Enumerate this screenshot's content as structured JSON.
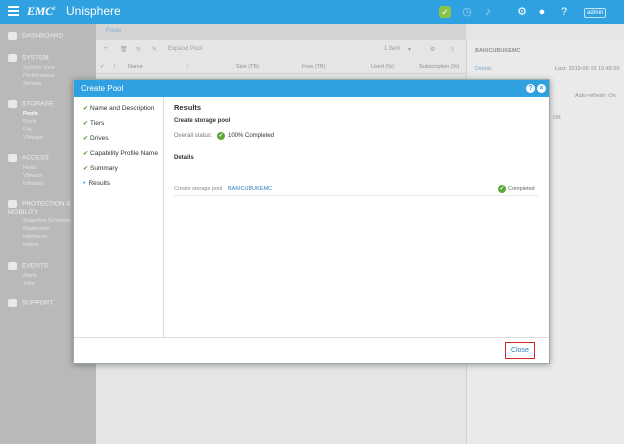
{
  "header": {
    "brand": "EMC",
    "brand_mark": "2",
    "product": "Unisphere",
    "user_label": "admin"
  },
  "icons": {
    "menu": "hamburger-icon",
    "status": "check-badge-icon",
    "tasks": "clock-icon",
    "alerts": "bell-icon",
    "settings": "gear-icon",
    "user": "user-icon",
    "help": "help-icon"
  },
  "sidebar": {
    "sections": [
      {
        "label": "DASHBOARD",
        "items": []
      },
      {
        "label": "SYSTEM",
        "items": [
          "System View",
          "Performance",
          "Service"
        ]
      },
      {
        "label": "STORAGE",
        "items": [
          "Pools",
          "Block",
          "File",
          "VMware"
        ]
      },
      {
        "label": "ACCESS",
        "items": [
          "Hosts",
          "VMware",
          "Initiators"
        ]
      },
      {
        "label": "PROTECTION & MOBILITY",
        "items": [
          "Snapshot Schedule",
          "Replication",
          "Interfaces",
          "Import"
        ]
      },
      {
        "label": "EVENTS",
        "items": [
          "Alerts",
          "Jobs"
        ]
      },
      {
        "label": "SUPPORT",
        "items": []
      }
    ],
    "active_item": "Pools"
  },
  "background": {
    "tab": "Pools",
    "toolbar": {
      "expand_pool": "Expand Pool",
      "item_count": "1 item"
    },
    "columns": [
      "!",
      "Name",
      "↑",
      "Size (TB)",
      "Free (TB)",
      "Used (%)",
      "Subscription (%)"
    ],
    "detail": {
      "title": "BAKICUBUKEMC",
      "link": "Details",
      "meta": "Last: 2019-06-19 10:45:00",
      "sub": "Auto-refresh: On",
      "ok": "OK"
    }
  },
  "modal": {
    "title": "Create Pool",
    "steps": [
      {
        "label": "Name and Description",
        "done": true
      },
      {
        "label": "Tiers",
        "done": true
      },
      {
        "label": "Drives",
        "done": true
      },
      {
        "label": "Capability Profile Name",
        "done": true
      },
      {
        "label": "Summary",
        "done": true
      },
      {
        "label": "Results",
        "done": false,
        "current": true
      }
    ],
    "results_title": "Results",
    "create_heading": "Create storage pool",
    "overall_label": "Overall status:",
    "overall_value": "100% Completed",
    "details_heading": "Details",
    "detail_prefix": "Create storage pool",
    "detail_pool": "BAKICUBUKEMC",
    "detail_status": "Completed",
    "close_label": "Close"
  },
  "colors": {
    "accent": "#2fa1e0",
    "success": "#5aa83a",
    "close_border": "#d9262c",
    "sidebar": "#b9b9b9"
  }
}
